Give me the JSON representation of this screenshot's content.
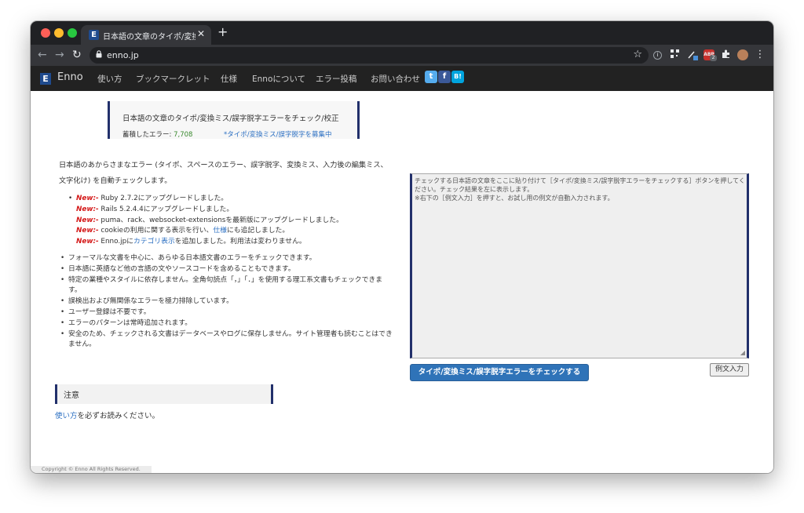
{
  "browser": {
    "tab_title": "日本語の文章のタイポ/変換ミス/誤字脱字エラーをチェック",
    "tab_favicon": "E",
    "close_symbol": "✕",
    "new_tab_symbol": "+",
    "url": "enno.jp",
    "back_symbol": "←",
    "forward_symbol": "→",
    "reload_symbol": "↻",
    "lock_symbol": "🔒",
    "star_symbol": "☆",
    "menu_symbol": "⋮",
    "ext_badge_1": "ABP",
    "ext_badge_count": "2"
  },
  "nav": {
    "brand_logo": "E",
    "brand": "Enno",
    "items": [
      "使い方",
      "ブックマークレット",
      "仕様",
      "Ennoについて",
      "エラー投稿",
      "お問い合わせ"
    ],
    "social": [
      "t",
      "f",
      "B!"
    ]
  },
  "banner": {
    "title": "日本語の文章のタイポ/変換ミス/誤字脱字エラーをチェック/校正",
    "count_label": "蓄積したエラー: ",
    "count_value": "7,708",
    "link": "*タイポ/変換ミス/誤字脱字を募集中"
  },
  "intro": "日本語のあからさまなエラー (タイポ、スペースのエラー、誤字脱字、変換ミス、入力後の編集ミス、文字化け) を自動チェックします。",
  "news": {
    "tag": "New:-",
    "line1": " Ruby 2.7.2にアップグレードしました。",
    "line2": " Rails 5.2.4.4にアップグレードしました。",
    "line3": " puma、rack、websocket-extensionsを最新版にアップグレードしました。",
    "line4_pre": " cookieの利用に関する表示を行い、",
    "line4_link": "仕様",
    "line4_post": "にも追記しました。",
    "line5_pre": " Enno.jpに",
    "line5_link": "カテゴリ表示",
    "line5_post": "を追加しました。利用法は変わりません。"
  },
  "features": [
    "フォーマルな文書を中心に、あらゆる日本語文書のエラーをチェックできます。",
    "日本語に英語など他の言語の文やソースコードを含めることもできます。",
    "特定の業種やスタイルに依存しません。全角句読点「，」「．」を使用する理工系文書もチェックできます。",
    "誤検出および無関係なエラーを極力排除しています。",
    "ユーザー登録は不要です。",
    "エラーのパターンは常時追加されます。",
    "安全のため、チェックされる文書はデータベースやログに保存しません。サイト管理者も読むことはできません。"
  ],
  "notice": {
    "title": "注意",
    "link": "使い方",
    "text": "を必ずお読みください。"
  },
  "editor": {
    "placeholder": "チェックする日本語の文章をここに貼り付けて［タイポ/変換ミス/誤字脱字エラーをチェックする］ボタンを押してください。チェック結果を左に表示します。\n※右下の［例文入力］を押すと、お試し用の例文が自動入力されます。",
    "check_button": "タイポ/変換ミス/誤字脱字エラーをチェックする",
    "sample_button": "例文入力"
  },
  "footer": "Copyright © Enno All Rights Reserved.",
  "colors": {
    "accent_navy": "#22306b",
    "button_blue": "#2f73b8",
    "new_red": "#d41818",
    "count_green": "#3a8a2f"
  }
}
